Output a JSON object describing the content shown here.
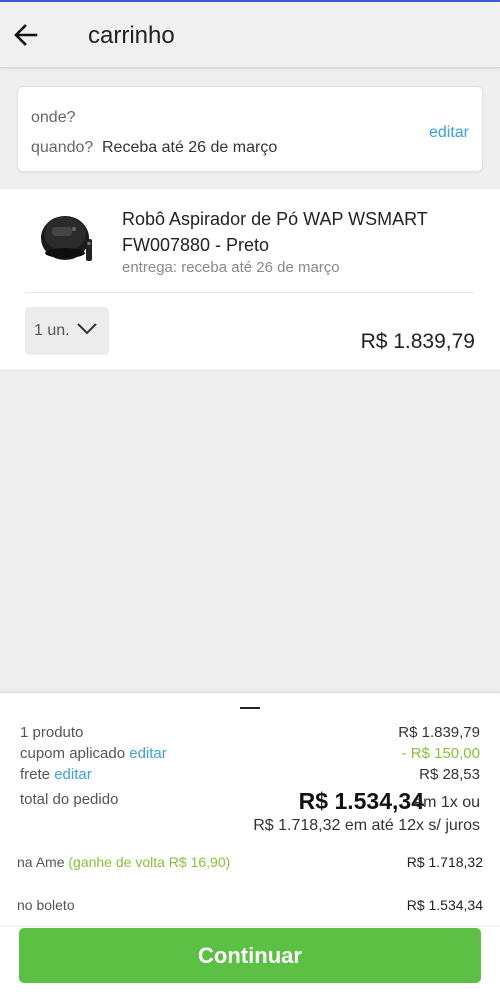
{
  "header": {
    "title": "carrinho",
    "back_icon": "arrow-left-icon"
  },
  "delivery": {
    "where_label": "onde?",
    "when_label": "quando?",
    "when_value": "Receba até 26 de março",
    "edit_label": "editar"
  },
  "product": {
    "image_icon": "robot-vacuum-icon",
    "title": "Robô Aspirador de Pó WAP WSMART FW007880 - Preto",
    "delivery": "entrega: receba até 26 de março",
    "quantity": "1 un.",
    "price": "R$ 1.839,79"
  },
  "summary": {
    "products_label": "1 produto",
    "products_value": "R$ 1.839,79",
    "coupon_label": "cupom aplicado",
    "coupon_edit": "editar",
    "coupon_value": "- R$ 150,00",
    "shipping_label": "frete",
    "shipping_edit": "editar",
    "shipping_value": "R$ 28,53",
    "total_label": "total do pedido",
    "total_value": "R$ 1.534,34",
    "total_mode": "em 1x ou",
    "installments": "R$ 1.718,32 em até 12x s/ juros",
    "ame_label": "na Ame",
    "ame_cashback": "(ganhe de volta R$ 16,90)",
    "ame_value": "R$ 1.718,32",
    "boleto_label": "no boleto",
    "boleto_value": "R$ 1.534,34",
    "continue_label": "Continuar"
  },
  "colors": {
    "accent_link": "#3aa0d8",
    "discount_green": "#8bbf3a",
    "button_green": "#5cc045"
  }
}
